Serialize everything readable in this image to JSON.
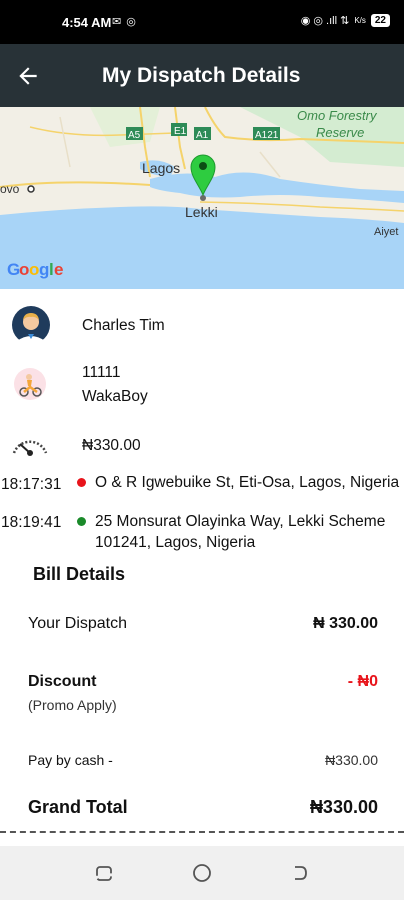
{
  "status_bar": {
    "time": "4:54 AM",
    "left_icons": "✉ ◎",
    "right_icons": "◉ ◎ .ıll ⇅",
    "signal_sub": "K/s",
    "battery": "22"
  },
  "app_bar": {
    "title": "My Dispatch Details",
    "back_icon": "arrow-left-icon"
  },
  "map": {
    "labels": {
      "lagos": "Lagos",
      "lekki": "Lekki",
      "ovo": "ovo",
      "aiyet": "Aiyet",
      "forest_line1": "Omo Forestry",
      "forest_line2": "Reserve",
      "road_a5": "A5",
      "road_e1": "E1",
      "road_a1": "A1",
      "road_a121": "A121"
    },
    "google_logo": {
      "g1": "G",
      "o1": "o",
      "o2": "o",
      "g2": "g",
      "l": "l",
      "e": "e"
    },
    "colors": {
      "water": "#a8d4f7",
      "land": "#f2efe6",
      "green_area": "#d4ecd1",
      "road": "#f5d36b",
      "pin": "#2ecc40"
    }
  },
  "driver": {
    "name": "Charles Tim",
    "avatar_icon": "driver-avatar-icon"
  },
  "vehicle": {
    "number": "11111",
    "type": "WakaBoy",
    "icon": "rider-icon"
  },
  "fare": {
    "amount": "₦330.00",
    "icon": "speedometer-icon"
  },
  "trip": {
    "pickup": {
      "time": "18:17:31",
      "address": "O & R Igwebuike St, Eti-Osa, Lagos, Nigeria",
      "dot_color": "#e8141b"
    },
    "dropoff": {
      "time": "18:19:41",
      "address_line1": "25 Monsurat Olayinka Way, Lekki Scheme",
      "address_line2": "101241, Lagos, Nigeria",
      "dot_color": "#1a8a2a"
    }
  },
  "bill": {
    "title": "Bill Details",
    "your_dispatch_label": "Your Dispatch",
    "your_dispatch_value": "₦ 330.00",
    "discount_label": "Discount",
    "promo_label": "(Promo Apply)",
    "discount_value": "- ₦0",
    "discount_color": "#e8141b",
    "pay_label": "Pay by cash -",
    "pay_value": "₦330.00",
    "grand_total_label": "Grand Total",
    "grand_total_value": "₦330.00"
  },
  "nav_bar": {
    "recents_icon": "recents-icon",
    "home_icon": "home-icon",
    "back_icon": "nav-back-icon"
  }
}
